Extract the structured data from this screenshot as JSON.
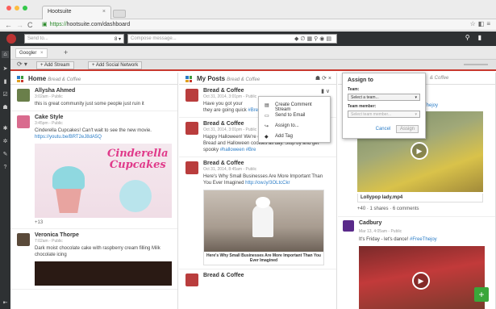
{
  "browser": {
    "tab_title": "Hootsuite",
    "url_prefix": "https://",
    "url_rest": "hootsuite.com/dashboard"
  },
  "topbar": {
    "send_to_placeholder": "Send to...",
    "send_to_count": "8",
    "compose_placeholder": "Compose message..."
  },
  "streams_tab": {
    "label": "Googler"
  },
  "actionbar": {
    "add_stream": "+ Add Stream",
    "add_network": "+ Add Social Network"
  },
  "columns": {
    "home": {
      "title": "Home",
      "subtitle": "Bread & Coffee",
      "posts": [
        {
          "name": "Allysha Ahmed",
          "meta": "3:02am - Public",
          "text": "this is great community just some people just ruin it"
        },
        {
          "name": "Cake Style",
          "meta": "3:45pm - Public",
          "text": "Cinderella Cupcakes! Can't wait to see the new movie.",
          "link": "https://youtu.be/BRT2eJ8dA5Q",
          "image_title_1": "Cinderella",
          "image_title_2": "Cupcakes",
          "count": "+13"
        },
        {
          "name": "Veronica Thorpe",
          "meta": "7:02am - Public",
          "text": "Dark moist chocolate cake with raspberry cream filling Milk chocolate icing"
        }
      ]
    },
    "my_posts": {
      "title": "My Posts",
      "subtitle": "Bread & Coffee",
      "posts": [
        {
          "name": "Bread & Coffee",
          "meta": "Oct 31, 2014, 3:01pm - Public",
          "text": "Have you got your",
          "text2": "they are going quick",
          "link": "#Bre"
        },
        {
          "name": "Bread & Coffee",
          "meta": "Oct 31, 2014, 3:01pm - Public",
          "text": "Happy Halloween! We're cooking up special Pumpkin Bread and Halloween cookies all day. Stop by and get spooky",
          "link": "#halloween #Bre"
        },
        {
          "name": "Bread & Coffee",
          "meta": "Oct 31, 2014, 8:45am - Public",
          "text": "Here's Why Small Businesses Are More Important Than You Ever Imagined",
          "link": "http://ow.ly/3OLtcCkr",
          "caption": "Here's Why Small Businesses Are More Important Than You Ever Imagined"
        },
        {
          "name": "Bread & Coffee"
        }
      ]
    },
    "third": {
      "subtitle": "& Coffee",
      "link_frag": "Thejoy",
      "video_title": "Lollypop lady.mp4",
      "video_stats": "+40 · 1 shares · 6 comments",
      "post_name": "Cadbury",
      "post_meta": "Mar 13, 4:05am - Public",
      "post_text": "It's Friday - let's dance!",
      "post_link": "#FreeThejoy"
    }
  },
  "context_menu": {
    "items": [
      "Create Comment Stream",
      "Send to Email",
      "Assign to...",
      "Add Tag"
    ]
  },
  "assign_popup": {
    "title": "Assign to",
    "team_label": "Team:",
    "team_value": "Select a team...",
    "member_label": "Team member:",
    "member_value": "Select team member...",
    "cancel": "Cancel",
    "assign": "Assign"
  },
  "colors": {
    "accent": "#c8372d",
    "link": "#2a7cc7",
    "sidebar": "#2e3133",
    "add_button": "#3aa63a"
  }
}
